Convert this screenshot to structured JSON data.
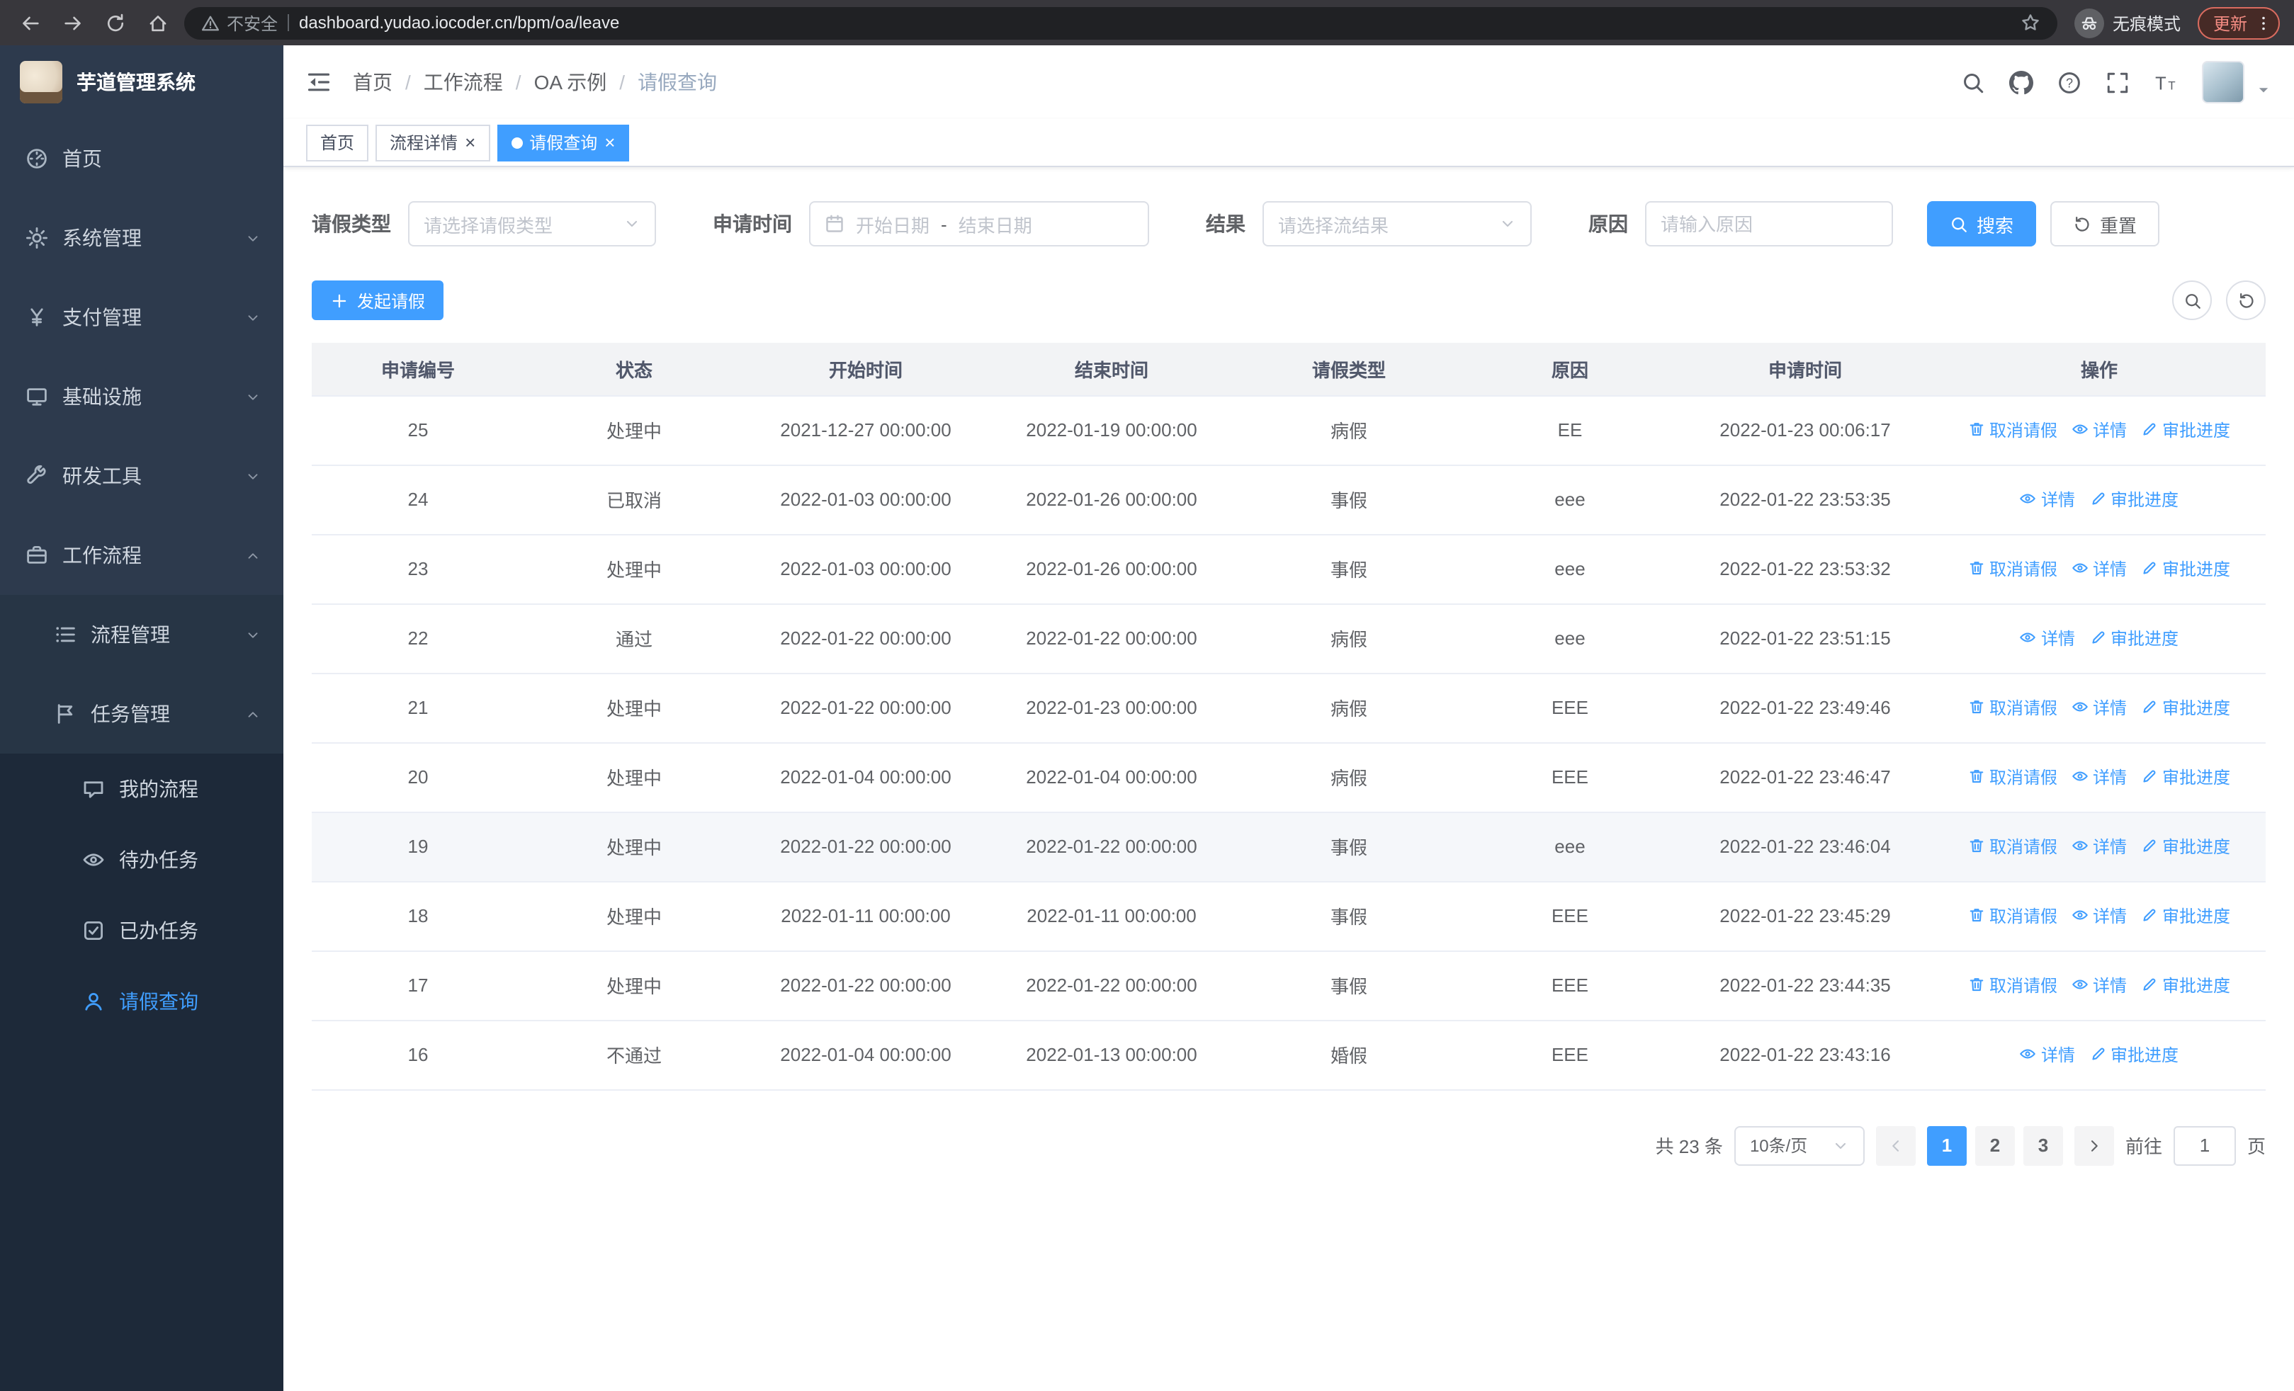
{
  "theme": {
    "accent": "#409eff",
    "sidebar_bg": "#2d3a4d",
    "sidebar_submenu_bg": "#1d2939",
    "header_row_bg": "#f2f3f5",
    "danger": "#f28b82"
  },
  "browser": {
    "security_warning": "不安全",
    "url": "dashboard.yudao.iocoder.cn/bpm/oa/leave",
    "incognito_label": "无痕模式",
    "update_label": "更新"
  },
  "sidebar": {
    "title": "芋道管理系统",
    "items": [
      {
        "key": "home",
        "label": "首页",
        "icon": "dashboard-icon",
        "level": 1,
        "chevron": null,
        "active": false
      },
      {
        "key": "system",
        "label": "系统管理",
        "icon": "gear-icon",
        "level": 1,
        "chevron": "down",
        "active": false
      },
      {
        "key": "payment",
        "label": "支付管理",
        "icon": "yen-icon",
        "level": 1,
        "chevron": "down",
        "active": false
      },
      {
        "key": "infrastructure",
        "label": "基础设施",
        "icon": "monitor-icon",
        "level": 1,
        "chevron": "down",
        "active": false
      },
      {
        "key": "devtools",
        "label": "研发工具",
        "icon": "wrench-icon",
        "level": 1,
        "chevron": "down",
        "active": false
      },
      {
        "key": "workflow",
        "label": "工作流程",
        "icon": "briefcase-icon",
        "level": 1,
        "chevron": "up",
        "active": false
      },
      {
        "key": "process-management",
        "label": "流程管理",
        "icon": "list-icon",
        "level": 2,
        "chevron": "down",
        "active": false
      },
      {
        "key": "task-management",
        "label": "任务管理",
        "icon": "flag-icon",
        "level": 2,
        "chevron": "up",
        "active": false
      },
      {
        "key": "my-process",
        "label": "我的流程",
        "icon": "chat-icon",
        "level": 3,
        "chevron": null,
        "active": false
      },
      {
        "key": "todo-tasks",
        "label": "待办任务",
        "icon": "eye-icon",
        "level": 3,
        "chevron": null,
        "active": false
      },
      {
        "key": "done-tasks",
        "label": "已办任务",
        "icon": "check-icon",
        "level": 3,
        "chevron": null,
        "active": false
      },
      {
        "key": "leave-query",
        "label": "请假查询",
        "icon": "user-icon",
        "level": 3,
        "chevron": null,
        "active": true
      }
    ]
  },
  "breadcrumb": [
    "首页",
    "工作流程",
    "OA 示例",
    "请假查询"
  ],
  "tabs": [
    {
      "key": "home",
      "label": "首页",
      "closable": false,
      "active": false
    },
    {
      "key": "process-detail",
      "label": "流程详情",
      "closable": true,
      "active": false
    },
    {
      "key": "leave-query",
      "label": "请假查询",
      "closable": true,
      "active": true
    }
  ],
  "filters": {
    "leave_type_label": "请假类型",
    "leave_type_placeholder": "请选择请假类型",
    "apply_time_label": "申请时间",
    "start_date_placeholder": "开始日期",
    "range_separator": "-",
    "end_date_placeholder": "结束日期",
    "result_label": "结果",
    "result_placeholder": "请选择流结果",
    "reason_label": "原因",
    "reason_placeholder": "请输入原因",
    "search_label": "搜索",
    "reset_label": "重置"
  },
  "toolbar": {
    "create_label": "发起请假"
  },
  "table": {
    "columns": [
      "申请编号",
      "状态",
      "开始时间",
      "结束时间",
      "请假类型",
      "原因",
      "申请时间",
      "操作"
    ],
    "action_labels": {
      "cancel": "取消请假",
      "detail": "详情",
      "progress": "审批进度"
    },
    "rows": [
      {
        "id": "25",
        "status": "处理中",
        "start": "2021-12-27 00:00:00",
        "end": "2022-01-19 00:00:00",
        "type": "病假",
        "reason": "EE",
        "applied": "2022-01-23 00:06:17",
        "actions": [
          "cancel",
          "detail",
          "progress"
        ],
        "highlighted": false
      },
      {
        "id": "24",
        "status": "已取消",
        "start": "2022-01-03 00:00:00",
        "end": "2022-01-26 00:00:00",
        "type": "事假",
        "reason": "eee",
        "applied": "2022-01-22 23:53:35",
        "actions": [
          "detail",
          "progress"
        ],
        "highlighted": false
      },
      {
        "id": "23",
        "status": "处理中",
        "start": "2022-01-03 00:00:00",
        "end": "2022-01-26 00:00:00",
        "type": "事假",
        "reason": "eee",
        "applied": "2022-01-22 23:53:32",
        "actions": [
          "cancel",
          "detail",
          "progress"
        ],
        "highlighted": false
      },
      {
        "id": "22",
        "status": "通过",
        "start": "2022-01-22 00:00:00",
        "end": "2022-01-22 00:00:00",
        "type": "病假",
        "reason": "eee",
        "applied": "2022-01-22 23:51:15",
        "actions": [
          "detail",
          "progress"
        ],
        "highlighted": false
      },
      {
        "id": "21",
        "status": "处理中",
        "start": "2022-01-22 00:00:00",
        "end": "2022-01-23 00:00:00",
        "type": "病假",
        "reason": "EEE",
        "applied": "2022-01-22 23:49:46",
        "actions": [
          "cancel",
          "detail",
          "progress"
        ],
        "highlighted": false
      },
      {
        "id": "20",
        "status": "处理中",
        "start": "2022-01-04 00:00:00",
        "end": "2022-01-04 00:00:00",
        "type": "病假",
        "reason": "EEE",
        "applied": "2022-01-22 23:46:47",
        "actions": [
          "cancel",
          "detail",
          "progress"
        ],
        "highlighted": false
      },
      {
        "id": "19",
        "status": "处理中",
        "start": "2022-01-22 00:00:00",
        "end": "2022-01-22 00:00:00",
        "type": "事假",
        "reason": "eee",
        "applied": "2022-01-22 23:46:04",
        "actions": [
          "cancel",
          "detail",
          "progress"
        ],
        "highlighted": true
      },
      {
        "id": "18",
        "status": "处理中",
        "start": "2022-01-11 00:00:00",
        "end": "2022-01-11 00:00:00",
        "type": "事假",
        "reason": "EEE",
        "applied": "2022-01-22 23:45:29",
        "actions": [
          "cancel",
          "detail",
          "progress"
        ],
        "highlighted": false
      },
      {
        "id": "17",
        "status": "处理中",
        "start": "2022-01-22 00:00:00",
        "end": "2022-01-22 00:00:00",
        "type": "事假",
        "reason": "EEE",
        "applied": "2022-01-22 23:44:35",
        "actions": [
          "cancel",
          "detail",
          "progress"
        ],
        "highlighted": false
      },
      {
        "id": "16",
        "status": "不通过",
        "start": "2022-01-04 00:00:00",
        "end": "2022-01-13 00:00:00",
        "type": "婚假",
        "reason": "EEE",
        "applied": "2022-01-22 23:43:16",
        "actions": [
          "detail",
          "progress"
        ],
        "highlighted": false
      }
    ]
  },
  "pagination": {
    "total": "共 23 条",
    "page_size": "10条/页",
    "pages": [
      "1",
      "2",
      "3"
    ],
    "active_page": "1",
    "goto_label": "前往",
    "goto_value": "1",
    "page_suffix": "页"
  }
}
